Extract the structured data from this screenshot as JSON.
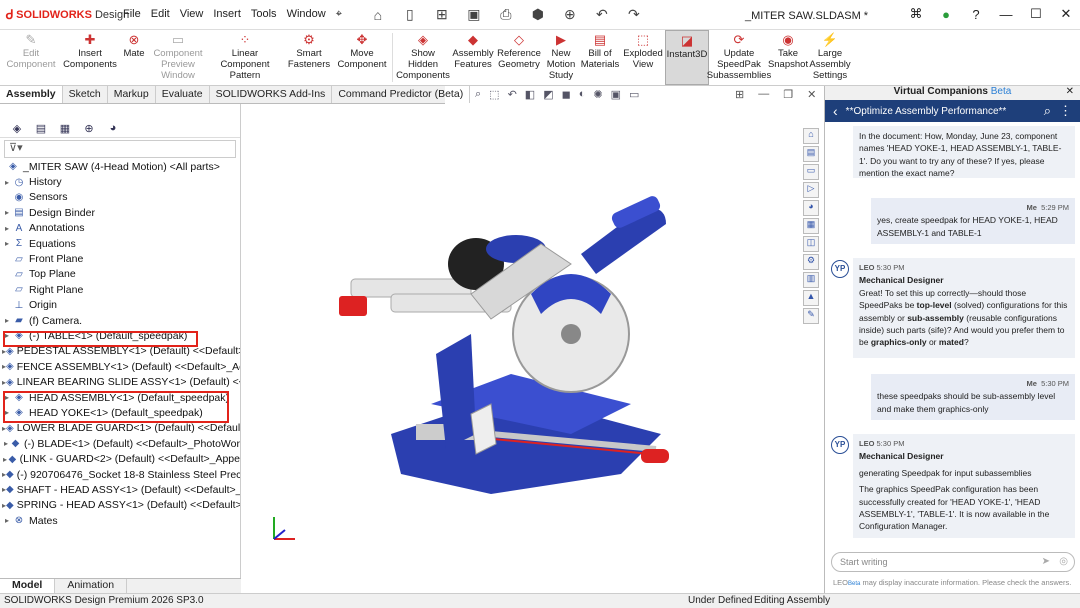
{
  "app": {
    "logo_brand": "SOLIDWORKS",
    "logo_product": "Design",
    "doc_title": "_MITER SAW.SLDASM *"
  },
  "menu": [
    "File",
    "Edit",
    "View",
    "Insert",
    "Tools",
    "Window"
  ],
  "ribbon": [
    {
      "label": "Edit Component",
      "disabled": true
    },
    {
      "label": "Insert Components",
      "disabled": false
    },
    {
      "label": "Mate",
      "disabled": false
    },
    {
      "label": "Component Preview Window",
      "disabled": true
    },
    {
      "label": "Linear Component Pattern",
      "disabled": false
    },
    {
      "label": "Smart Fasteners",
      "disabled": false
    },
    {
      "label": "Move Component",
      "disabled": false
    },
    {
      "label": "Show Hidden Components",
      "disabled": false
    },
    {
      "label": "Assembly Features",
      "disabled": false
    },
    {
      "label": "Reference Geometry",
      "disabled": false
    },
    {
      "label": "New Motion Study",
      "disabled": false
    },
    {
      "label": "Bill of Materials",
      "disabled": false
    },
    {
      "label": "Exploded View",
      "disabled": false
    },
    {
      "label": "Instant3D",
      "disabled": false,
      "active": true
    },
    {
      "label": "Update SpeedPak Subassemblies",
      "disabled": false
    },
    {
      "label": "Take Snapshot",
      "disabled": false
    },
    {
      "label": "Large Assembly Settings",
      "disabled": false
    }
  ],
  "tabs": [
    "Assembly",
    "Sketch",
    "Markup",
    "Evaluate",
    "SOLIDWORKS Add-Ins",
    "Command Predictor (Beta)"
  ],
  "filter_text": "▾",
  "tree": [
    {
      "label": "_MITER SAW (4-Head Motion) <All parts>",
      "icon": "assembly-icon",
      "arrow": false,
      "indent": 0
    },
    {
      "label": "History",
      "icon": "history-icon",
      "arrow": true,
      "indent": 1
    },
    {
      "label": "Sensors",
      "icon": "sensor-icon",
      "arrow": false,
      "indent": 1
    },
    {
      "label": "Design Binder",
      "icon": "binder-icon",
      "arrow": true,
      "indent": 1
    },
    {
      "label": "Annotations",
      "icon": "annotation-icon",
      "arrow": true,
      "indent": 1
    },
    {
      "label": "Equations",
      "icon": "equation-icon",
      "arrow": true,
      "indent": 1
    },
    {
      "label": "Front Plane",
      "icon": "plane-icon",
      "arrow": false,
      "indent": 1
    },
    {
      "label": "Top Plane",
      "icon": "plane-icon",
      "arrow": false,
      "indent": 1
    },
    {
      "label": "Right Plane",
      "icon": "plane-icon",
      "arrow": false,
      "indent": 1
    },
    {
      "label": "Origin",
      "icon": "origin-icon",
      "arrow": false,
      "indent": 1
    },
    {
      "label": "(f) Camera.",
      "icon": "folder-icon",
      "arrow": true,
      "indent": 1
    },
    {
      "label": "(-) TABLE<1> (Default_speedpak)",
      "icon": "component-icon",
      "arrow": true,
      "indent": 1
    },
    {
      "label": "PEDESTAL ASSEMBLY<1> (Default) <<Default>_A",
      "icon": "component-icon",
      "arrow": true,
      "indent": 1
    },
    {
      "label": "FENCE ASSEMBLY<1> (Default) <<Default>_Ac",
      "icon": "component-icon",
      "arrow": true,
      "indent": 1
    },
    {
      "label": "LINEAR BEARING SLIDE ASSY<1> (Default) <<D",
      "icon": "component-icon",
      "arrow": true,
      "indent": 1
    },
    {
      "label": "HEAD ASSEMBLY<1> (Default_speedpak)",
      "icon": "component-icon",
      "arrow": true,
      "indent": 1
    },
    {
      "label": "HEAD YOKE<1> (Default_speedpak)",
      "icon": "component-icon",
      "arrow": true,
      "indent": 1
    },
    {
      "label": "LOWER BLADE GUARD<1> (Default) <<Default",
      "icon": "component-icon",
      "arrow": true,
      "indent": 1
    },
    {
      "label": "(-) BLADE<1> (Default) <<Default>_PhotoWor",
      "icon": "part-icon",
      "arrow": true,
      "indent": 1
    },
    {
      "label": "(LINK - GUARD<2> (Default) <<Default>_Appe",
      "icon": "part-icon",
      "arrow": true,
      "indent": 1
    },
    {
      "label": "(-) 920706476_Socket 18-8 Stainless Steel Prec.",
      "icon": "part-icon",
      "arrow": true,
      "indent": 1
    },
    {
      "label": "SHAFT - HEAD ASSY<1> (Default) <<Default>_",
      "icon": "part-icon",
      "arrow": true,
      "indent": 1
    },
    {
      "label": "SPRING - HEAD ASSY<1> (Default) <<Default>_",
      "icon": "part-icon",
      "arrow": true,
      "indent": 1
    },
    {
      "label": "Mates",
      "icon": "mates-icon",
      "arrow": true,
      "indent": 1
    }
  ],
  "bottom_tabs": [
    "Model",
    "Animation"
  ],
  "assistant": {
    "panel_title": "Virtual Companions",
    "beta": "Beta",
    "topic": "**Optimize Assembly Performance**",
    "messages": [
      {
        "who": "bot",
        "text": "In the document: How, Monday, June 23, component names 'HEAD YOKE-1, HEAD ASSEMBLY-1, TABLE-1'. Do you want to try any of these? If yes, please mention the exact name?"
      },
      {
        "who": "me",
        "sender": "Me",
        "time": "5:29 PM",
        "text": "yes, create speedpak for HEAD YOKE-1, HEAD ASSEMBLY-1 and TABLE-1"
      },
      {
        "who": "bot",
        "sender": "LEO",
        "time": "5:30 PM",
        "role": "Mechanical Designer",
        "p1": "Great! To set this up correctly—should those SpeedPaks be",
        "b1": "top-level",
        "p2": "(solved) configurations for this assembly or",
        "b2": "sub-assembly",
        "p3": "(reusable configurations inside) such parts (sife)? And would you prefer them to be",
        "b3": "graphics-only",
        "p4": "or",
        "b4": "mated",
        "p5": "?"
      },
      {
        "who": "me",
        "sender": "Me",
        "time": "5:30 PM",
        "text": "these speedpaks should be sub-assembly level and make them graphics-only"
      },
      {
        "who": "bot",
        "sender": "LEO",
        "time": "5:30 PM",
        "role": "Mechanical Designer",
        "t1": "generating Speedpak for input subassemblies",
        "t2": "The graphics SpeedPak configuration has been successfully created for 'HEAD YOKE-1', 'HEAD ASSEMBLY-1', 'TABLE-1'. It is now available in the Configuration Manager."
      }
    ],
    "input_placeholder": "Start writing",
    "disclaimer_brand": "LEO",
    "disclaimer_text": "may display inaccurate information. Please check the answers."
  },
  "status": {
    "version": "SOLIDWORKS Design Premium 2026 SP3.0",
    "state": "Under Defined",
    "mode": "Editing Assembly"
  },
  "colors": {
    "brand": "#e2231a",
    "header": "#1e3f7a",
    "model_blue": "#2b3fb0",
    "highlight": "#e2231a"
  }
}
